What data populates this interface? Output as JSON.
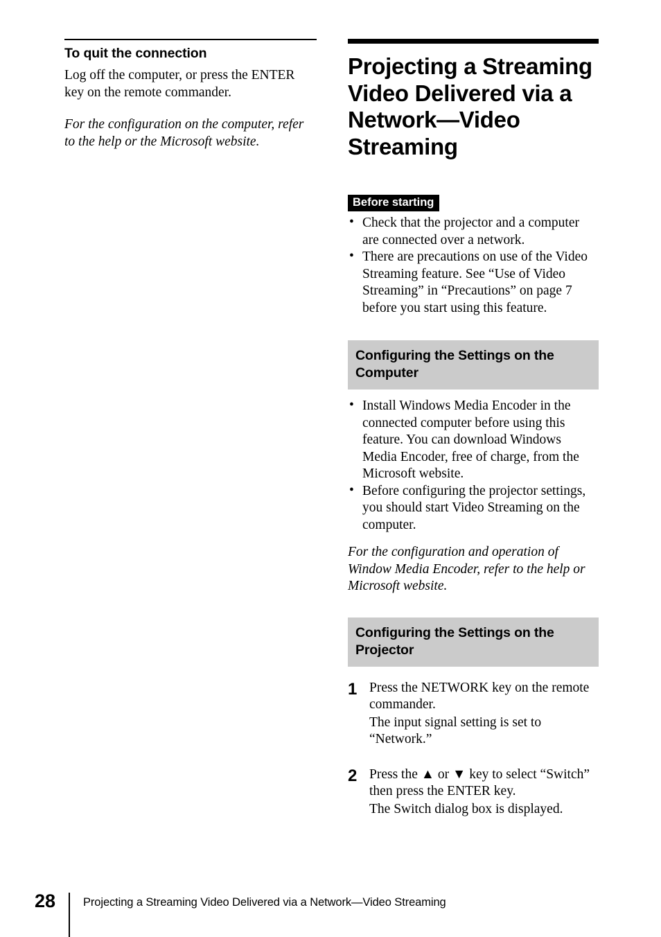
{
  "left_column": {
    "heading": "To quit the connection",
    "paragraph": "Log off the computer, or press the ENTER key on the remote commander.",
    "note": "For the configuration on the computer, refer to the help or the Microsoft website."
  },
  "right_column": {
    "chapter_title": "Projecting a Streaming Video Delivered via a Network—Video Streaming",
    "before_starting": {
      "badge_label": "Before starting",
      "bullets": [
        "Check that the projector and a computer are connected over a network.",
        "There are precautions on use of the Video Streaming feature. See “Use of Video Streaming” in “Precautions” on page 7 before you start using this feature."
      ]
    },
    "section_computer": {
      "heading": "Configuring the Settings on the Computer",
      "bullets": [
        "Install Windows Media Encoder in the connected computer before using this feature. You can download Windows Media Encoder, free of charge, from the Microsoft website.",
        "Before configuring the projector settings, you should start Video Streaming on the computer."
      ],
      "note": "For the configuration and operation of Window Media Encoder, refer to the help or Microsoft website."
    },
    "section_projector": {
      "heading": "Configuring the Settings on the Projector",
      "steps": [
        {
          "number": "1",
          "instruction": "Press the NETWORK key on the remote commander.",
          "result": "The input signal setting is set to “Network.”"
        },
        {
          "number": "2",
          "instruction": "Press the ▲ or ▼ key to select “Switch” then press the ENTER key.",
          "result": "The Switch dialog box is displayed."
        }
      ]
    }
  },
  "footer": {
    "page_number": "28",
    "text": "Projecting a Streaming Video Delivered via a Network—Video Streaming"
  },
  "bullet_glyph": "•",
  "colors": {
    "band_gray": "#cbcbcb",
    "ink": "#000000",
    "paper": "#ffffff"
  }
}
